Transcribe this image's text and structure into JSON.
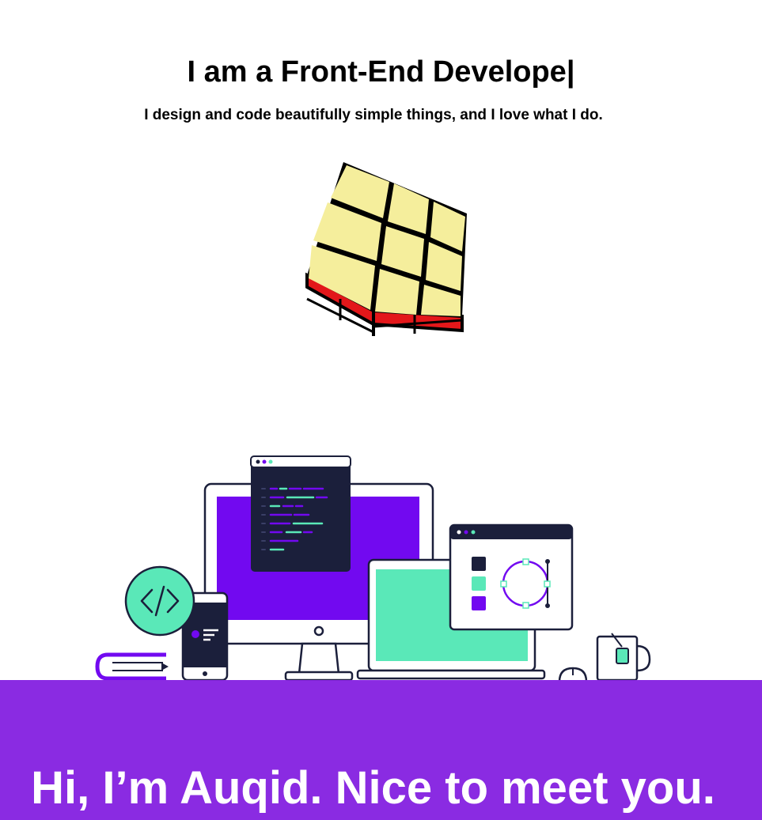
{
  "hero": {
    "headline": "I am a Front-End Develope",
    "caret": "|",
    "tagline": "I design and code beautifully simple things, and I love what I do."
  },
  "illustration": {
    "code_icon": "code-icon"
  },
  "banner": {
    "text": "Hi, I’m Auqid. Nice to meet you."
  },
  "colors": {
    "purple": "#7209f0",
    "banner_purple": "#8a2be2",
    "mint": "#5ae8b8",
    "navy": "#1b1f3b",
    "cube_yellow": "#f5ee9c",
    "cube_red": "#e3171a"
  }
}
